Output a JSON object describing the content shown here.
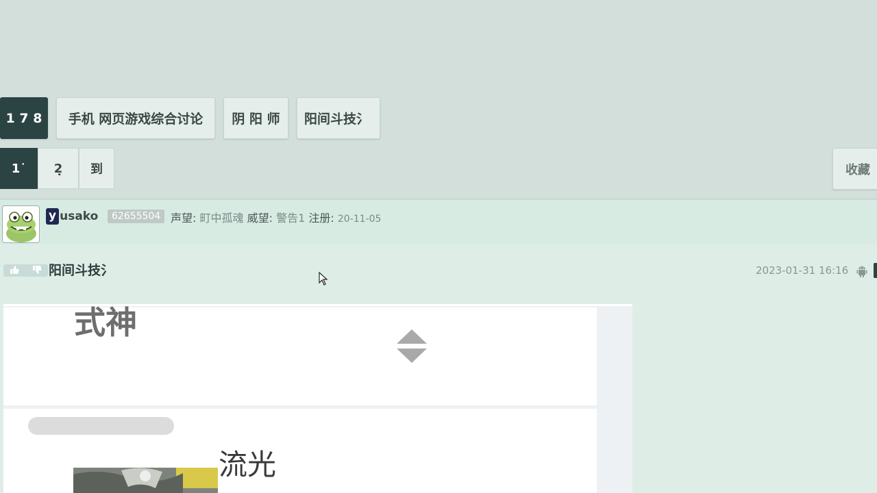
{
  "breadcrumb": {
    "items": [
      {
        "label": "1 7 8"
      },
      {
        "label": "手机 网页游戏综合讨论"
      },
      {
        "label": "阴 阳 师"
      },
      {
        "label": "阳间斗技氵"
      }
    ]
  },
  "pager": {
    "current": "1˙",
    "next": "2̣",
    "goto": "到"
  },
  "favorite_label": "收藏",
  "post": {
    "author_first": "y",
    "author_rest": "usako",
    "user_id": "62655504",
    "reputation_label": "声望:",
    "reputation_value": "町中孤魂",
    "prestige_label": "威望:",
    "prestige_value": "警告1",
    "register_label": "注册:",
    "register_value": "20-11-05",
    "title": "阳间斗技氵",
    "time": "2023-01-31 16:16"
  },
  "image": {
    "top_text": "式神",
    "card_text": "流光"
  },
  "colors": {
    "accent_dark": "#2b4443",
    "page_bg": "#d3dfdb",
    "post_bg": "#deeee7"
  }
}
